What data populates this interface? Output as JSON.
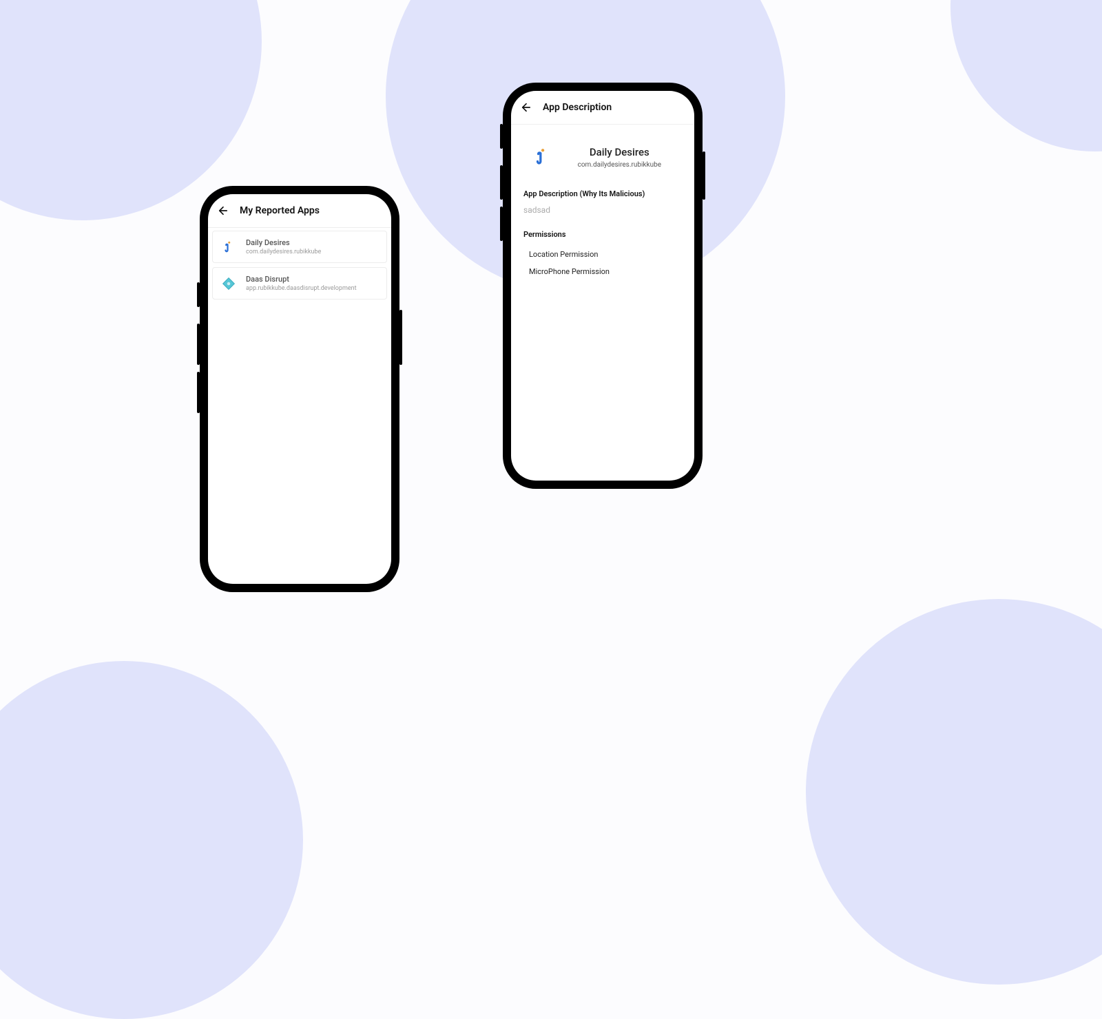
{
  "phone1": {
    "header": {
      "title": "My Reported Apps"
    },
    "apps": [
      {
        "name": "Daily Desires",
        "package": "com.dailydesires.rubikkube",
        "icon": "d-icon"
      },
      {
        "name": "Daas Disrupt",
        "package": "app.rubikkube.daasdisrupt.development",
        "icon": "diamond-icon"
      }
    ]
  },
  "phone2": {
    "header": {
      "title": "App Description"
    },
    "app": {
      "name": "Daily Desires",
      "package": "com.dailydesires.rubikkube",
      "icon": "d-icon"
    },
    "section_description_label": "App Description (Why Its Malicious)",
    "description_text": "sadsad",
    "section_permissions_label": "Permissions",
    "permissions": [
      "Location Permission",
      "MicroPhone Permission"
    ]
  }
}
